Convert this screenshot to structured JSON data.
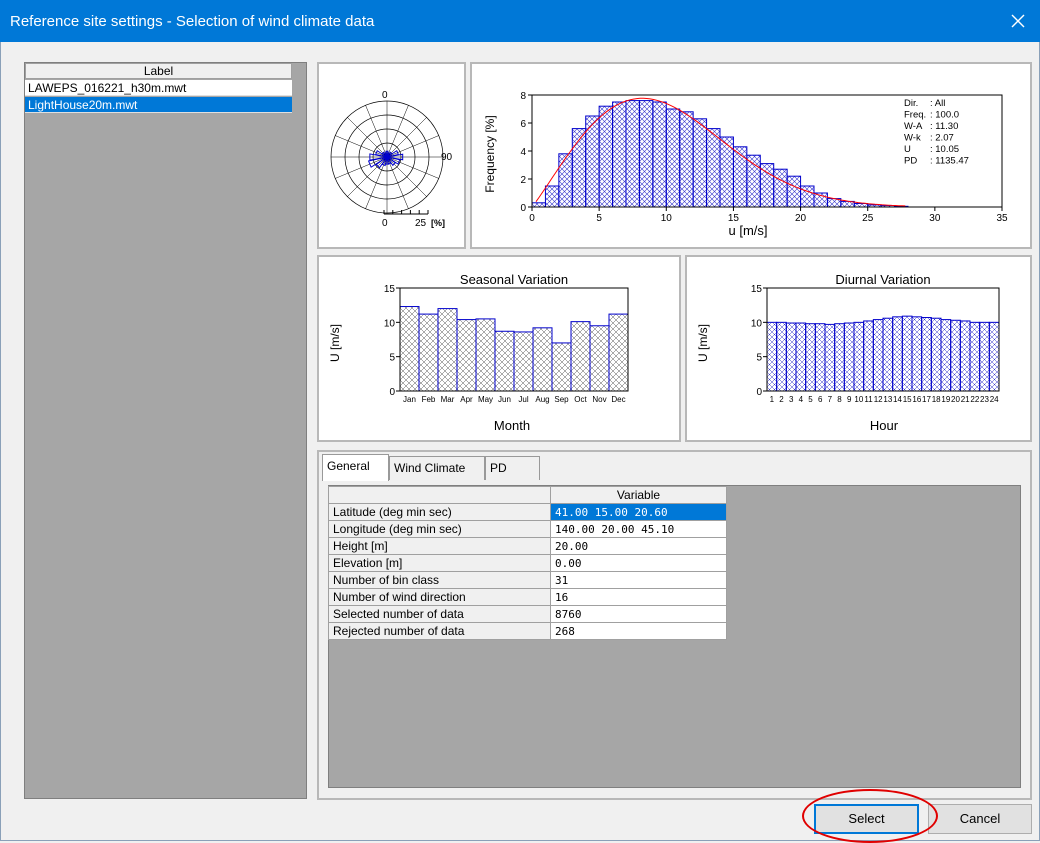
{
  "window": {
    "title": "Reference site settings - Selection of wind climate data",
    "close_glyph": "✕"
  },
  "file_list": {
    "header": "Label",
    "items": [
      {
        "label": "LAWEPS_016221_h30m.mwt",
        "selected": false
      },
      {
        "label": "LightHouse20m.mwt",
        "selected": true
      }
    ]
  },
  "wind_rose": {
    "label_north": "0",
    "label_east": "90",
    "scale_zero": "0",
    "scale_max": "25",
    "scale_unit": "[%]"
  },
  "frequency_chart": {
    "ylabel": "Frequency [%]",
    "xlabel": "u [m/s]",
    "y_ticks": [
      "0",
      "2",
      "4",
      "6",
      "8"
    ],
    "x_ticks": [
      "0",
      "5",
      "10",
      "15",
      "20",
      "25",
      "30",
      "35"
    ],
    "stats": [
      {
        "key": "Dir.",
        "value": ": All"
      },
      {
        "key": "Freq.",
        "value": ": 100.0"
      },
      {
        "key": "W-A",
        "value": ": 11.30"
      },
      {
        "key": "W-k",
        "value": ": 2.07"
      },
      {
        "key": "U",
        "value": ": 10.05"
      },
      {
        "key": "PD",
        "value": ": 1135.47"
      }
    ]
  },
  "seasonal_chart": {
    "title": "Seasonal Variation",
    "ylabel": "U [m/s]",
    "xlabel": "Month",
    "y_ticks": [
      "0",
      "5",
      "10",
      "15"
    ],
    "categories": [
      "Jan",
      "Feb",
      "Mar",
      "Apr",
      "May",
      "Jun",
      "Jul",
      "Aug",
      "Sep",
      "Oct",
      "Nov",
      "Dec"
    ]
  },
  "diurnal_chart": {
    "title": "Diurnal Variation",
    "ylabel": "U [m/s]",
    "xlabel": "Hour",
    "y_ticks": [
      "0",
      "5",
      "10",
      "15"
    ],
    "categories": [
      "1",
      "2",
      "3",
      "4",
      "5",
      "6",
      "7",
      "8",
      "9",
      "10",
      "11",
      "12",
      "13",
      "14",
      "15",
      "16",
      "17",
      "18",
      "19",
      "20",
      "21",
      "22",
      "23",
      "24"
    ]
  },
  "chart_data": [
    {
      "type": "bar",
      "xlabel": "u [m/s]",
      "ylabel": "Frequency [%]",
      "xlim": [
        0,
        35
      ],
      "ylim": [
        0,
        8
      ],
      "x": [
        0.5,
        1.5,
        2.5,
        3.5,
        4.5,
        5.5,
        6.5,
        7.5,
        8.5,
        9.5,
        10.5,
        11.5,
        12.5,
        13.5,
        14.5,
        15.5,
        16.5,
        17.5,
        18.5,
        19.5,
        20.5,
        21.5,
        22.5,
        23.5,
        24.5,
        25.5,
        26.5,
        27.5
      ],
      "values": [
        0.3,
        1.5,
        3.8,
        5.6,
        6.5,
        7.2,
        7.5,
        7.6,
        7.6,
        7.5,
        7.0,
        6.8,
        6.3,
        5.6,
        5.0,
        4.3,
        3.7,
        3.1,
        2.7,
        2.2,
        1.5,
        1.0,
        0.6,
        0.4,
        0.25,
        0.15,
        0.1,
        0.05
      ],
      "fit_curve": "Weibull"
    },
    {
      "type": "bar",
      "title": "Seasonal Variation",
      "xlabel": "Month",
      "ylabel": "U [m/s]",
      "ylim": [
        0,
        15
      ],
      "categories": [
        "Jan",
        "Feb",
        "Mar",
        "Apr",
        "May",
        "Jun",
        "Jul",
        "Aug",
        "Sep",
        "Oct",
        "Nov",
        "Dec"
      ],
      "values": [
        12.3,
        11.2,
        12.0,
        10.4,
        10.5,
        8.7,
        8.6,
        9.2,
        7.0,
        10.1,
        9.5,
        11.2
      ]
    },
    {
      "type": "bar",
      "title": "Diurnal Variation",
      "xlabel": "Hour",
      "ylabel": "U [m/s]",
      "ylim": [
        0,
        15
      ],
      "categories": [
        "1",
        "2",
        "3",
        "4",
        "5",
        "6",
        "7",
        "8",
        "9",
        "10",
        "11",
        "12",
        "13",
        "14",
        "15",
        "16",
        "17",
        "18",
        "19",
        "20",
        "21",
        "22",
        "23",
        "24"
      ],
      "values": [
        10.0,
        10.0,
        9.9,
        9.9,
        9.8,
        9.8,
        9.7,
        9.8,
        9.9,
        10.0,
        10.2,
        10.4,
        10.6,
        10.8,
        10.9,
        10.8,
        10.7,
        10.6,
        10.4,
        10.3,
        10.2,
        10.0,
        10.0,
        10.0
      ]
    }
  ],
  "tabs": [
    {
      "label": "General",
      "active": true
    },
    {
      "label": "Wind Climate",
      "active": false
    },
    {
      "label": "PD",
      "active": false
    }
  ],
  "general_table": {
    "column_header": "Variable",
    "rows": [
      {
        "label": "Latitude (deg min sec)",
        "value": "41.00 15.00 20.60"
      },
      {
        "label": "Longitude (deg min sec)",
        "value": "140.00 20.00 45.10"
      },
      {
        "label": "Height [m]",
        "value": "20.00"
      },
      {
        "label": "Elevation [m]",
        "value": "0.00"
      },
      {
        "label": "Number of bin class",
        "value": "31"
      },
      {
        "label": "Number of wind direction",
        "value": "16"
      },
      {
        "label": "Selected number of data",
        "value": "8760"
      },
      {
        "label": "Rejected number of data",
        "value": "268"
      }
    ]
  },
  "buttons": {
    "select": "Select",
    "cancel": "Cancel"
  },
  "colors": {
    "titlebar": "#0078d7",
    "selection": "#0078d7",
    "bar_stroke": "#0000cc",
    "fit_curve": "#ff0000",
    "highlight": "#e00000"
  }
}
